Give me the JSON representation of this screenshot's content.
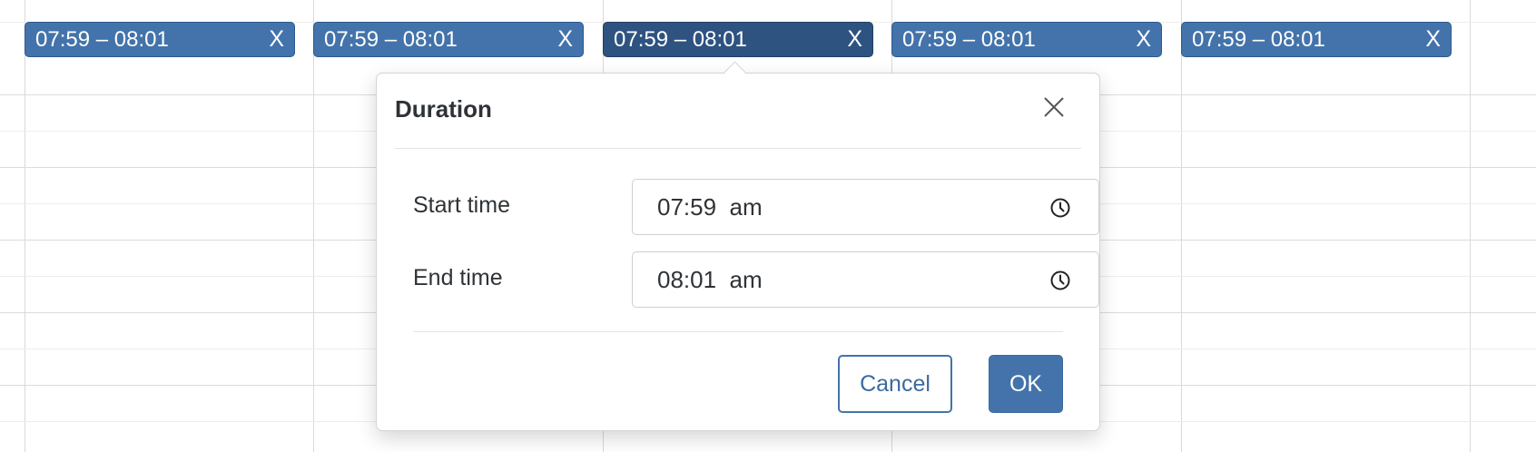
{
  "events": [
    {
      "label": "07:59 – 08:01",
      "close": "X",
      "active": false
    },
    {
      "label": "07:59 – 08:01",
      "close": "X",
      "active": false
    },
    {
      "label": "07:59 – 08:01",
      "close": "X",
      "active": true
    },
    {
      "label": "07:59 – 08:01",
      "close": "X",
      "active": false
    },
    {
      "label": "07:59 – 08:01",
      "close": "X",
      "active": false
    }
  ],
  "dialog": {
    "title": "Duration",
    "close_icon": "close-icon",
    "start": {
      "label": "Start time",
      "value": "07:59  am",
      "icon": "clock-icon"
    },
    "end": {
      "label": "End time",
      "value": "08:01  am",
      "icon": "clock-icon"
    },
    "cancel_label": "Cancel",
    "ok_label": "OK"
  },
  "colors": {
    "event_chip": "#4373aa",
    "event_chip_active": "#2e5380",
    "primary_button": "#4373aa",
    "grid_line": "#dcdcdc"
  }
}
